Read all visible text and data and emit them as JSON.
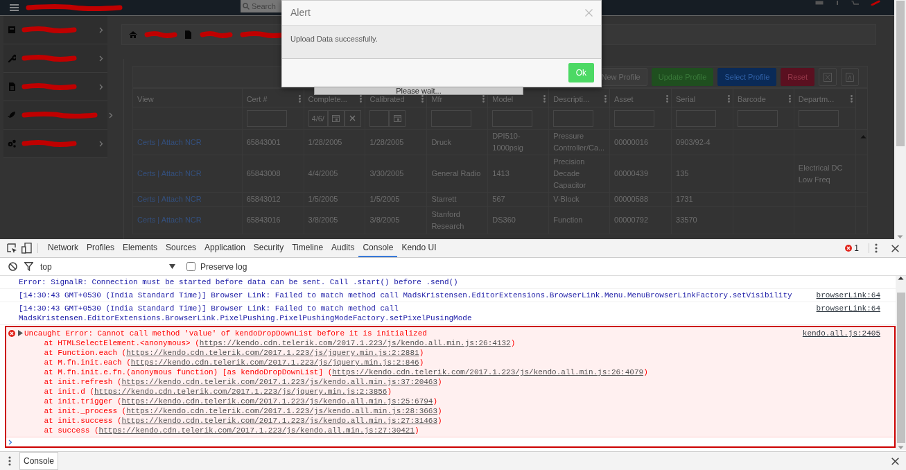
{
  "navbar": {
    "brand_redacted": true,
    "search": {
      "placeholder": "Search"
    },
    "corner_redacted": true
  },
  "sidebar": {
    "items": [
      {
        "redacted": true
      },
      {
        "redacted": true
      },
      {
        "redacted": true
      },
      {
        "redacted": true
      },
      {
        "redacted": true
      }
    ]
  },
  "breadcrumb": {
    "items": [
      {
        "redacted": true
      },
      {
        "redacted": true
      },
      {
        "redacted": true
      }
    ]
  },
  "toolbar": {
    "buttons": [
      {
        "label": "New Profile",
        "kind": "default"
      },
      {
        "label": "Update Profile",
        "kind": "success"
      },
      {
        "label": "Select Profile",
        "kind": "primary"
      },
      {
        "label": "Reset",
        "kind": "danger"
      }
    ]
  },
  "table": {
    "columns": [
      {
        "label": "View",
        "menu": false
      },
      {
        "label": "Cert #",
        "menu": true
      },
      {
        "label": "Complete...",
        "menu": true
      },
      {
        "label": "Calibrated",
        "menu": true
      },
      {
        "label": "Mfr",
        "menu": true
      },
      {
        "label": "Model",
        "menu": true
      },
      {
        "label": "Descripti...",
        "menu": true
      },
      {
        "label": "Asset",
        "menu": true
      },
      {
        "label": "Serial",
        "menu": true
      },
      {
        "label": "Barcode",
        "menu": true
      },
      {
        "label": "Departm...",
        "menu": true
      }
    ],
    "filters": [
      {
        "kind": "none"
      },
      {
        "kind": "text"
      },
      {
        "kind": "date",
        "value": "4/6/",
        "clearable": true
      },
      {
        "kind": "date",
        "clearable": false
      },
      {
        "kind": "text"
      },
      {
        "kind": "text"
      },
      {
        "kind": "text"
      },
      {
        "kind": "text"
      },
      {
        "kind": "text"
      },
      {
        "kind": "text"
      },
      {
        "kind": "text"
      }
    ],
    "rows": [
      {
        "cells": [
          {
            "links": [
              "Certs",
              "|",
              "Attach NCR"
            ]
          },
          "65843001",
          "1/28/2005",
          "1/28/2005",
          "Druck",
          "DPI510-1000psig",
          "Pressure Controller/Ca...",
          "00000016",
          "0903/92-4",
          "",
          ""
        ]
      },
      {
        "cells": [
          {
            "links": [
              "Certs",
              "|",
              "Attach NCR"
            ]
          },
          "65843008",
          "4/4/2005",
          "3/30/2005",
          "General Radio",
          "1413",
          "Precision Decade Capacitor",
          "00000439",
          "135",
          "",
          "Electrical DC Low Freq"
        ]
      },
      {
        "cells": [
          {
            "links": [
              "Certs",
              "|",
              "Attach NCR"
            ]
          },
          "65843012",
          "1/5/2005",
          "1/5/2005",
          "Starrett",
          "567",
          "V-Block",
          "00000588",
          "1731",
          "",
          ""
        ]
      },
      {
        "cells": [
          {
            "links": [
              "Certs",
              "|",
              "Attach NCR"
            ]
          },
          "65843016",
          "3/8/2005",
          "3/8/2005",
          "Stanford Research",
          "DS360",
          "Function",
          "00000792",
          "33570",
          "",
          ""
        ]
      }
    ]
  },
  "modal": {
    "title": "Alert",
    "message": "Upload Data successfully.",
    "ok": "Ok"
  },
  "loading": {
    "text": "Please wait..."
  },
  "devtools": {
    "tabs": [
      {
        "label": "Network",
        "selected": false
      },
      {
        "label": "Profiles",
        "selected": false
      },
      {
        "label": "Elements",
        "selected": false
      },
      {
        "label": "Sources",
        "selected": false
      },
      {
        "label": "Application",
        "selected": false
      },
      {
        "label": "Security",
        "selected": false
      },
      {
        "label": "Timeline",
        "selected": false
      },
      {
        "label": "Audits",
        "selected": false
      },
      {
        "label": "Console",
        "selected": true
      },
      {
        "label": "Kendo UI",
        "selected": false
      }
    ],
    "error_count": "1",
    "context": "top",
    "preserve_log": {
      "label": "Preserve log",
      "checked": false
    },
    "messages": [
      {
        "kind": "log",
        "text": "Error: SignalR: Connection must be started before data can be sent. Call .start() before .send()"
      },
      {
        "kind": "log",
        "text": "[14:30:43 GMT+0530 (India Standard Time)] Browser Link: Failed to match method call MadsKristensen.EditorExtensions.BrowserLink.Menu.MenuBrowserLinkFactory.setVisibility",
        "source": "browserLink:64"
      },
      {
        "kind": "log",
        "text": "[14:30:43 GMT+0530 (India Standard Time)] Browser Link: Failed to match method call MadsKristensen.EditorExtensions.BrowserLink.PixelPushing.PixelPushingModeFactory.setPixelPusingMode",
        "source": "browserLink:64"
      },
      {
        "kind": "error",
        "expanded": false,
        "text": "Uncaught Error: Cannot call method 'value' of kendoDropDownList before it is initialized",
        "source": "kendo.all.js:2405",
        "stack": [
          {
            "call": "at HTMLSelectElement.<anonymous> (",
            "url": "https://kendo.cdn.telerik.com/2017.1.223/js/kendo.all.min.js:26:4132",
            "end": ")"
          },
          {
            "call": "at Function.each (",
            "url": "https://kendo.cdn.telerik.com/2017.1.223/js/jquery.min.js:2:2881",
            "end": ")"
          },
          {
            "call": "at M.fn.init.each (",
            "url": "https://kendo.cdn.telerik.com/2017.1.223/js/jquery.min.js:2:846",
            "end": ")"
          },
          {
            "call": "at M.fn.init.e.fn.(anonymous function) [as kendoDropDownList] (",
            "url": "https://kendo.cdn.telerik.com/2017.1.223/js/kendo.all.min.js:26:4079",
            "end": ")"
          },
          {
            "call": "at init.refresh (",
            "url": "https://kendo.cdn.telerik.com/2017.1.223/js/kendo.all.min.js:37:20463",
            "end": ")"
          },
          {
            "call": "at init.d (",
            "url": "https://kendo.cdn.telerik.com/2017.1.223/js/jquery.min.js:2:3856",
            "end": ")"
          },
          {
            "call": "at init.trigger (",
            "url": "https://kendo.cdn.telerik.com/2017.1.223/js/kendo.all.min.js:25:6794",
            "end": ")"
          },
          {
            "call": "at init._process (",
            "url": "https://kendo.cdn.telerik.com/2017.1.223/js/kendo.all.min.js:28:3663",
            "end": ")"
          },
          {
            "call": "at init.success (",
            "url": "https://kendo.cdn.telerik.com/2017.1.223/js/kendo.all.min.js:27:31463",
            "end": ")"
          },
          {
            "call": "at success (",
            "url": "https://kendo.cdn.telerik.com/2017.1.223/js/kendo.all.min.js:27:30421",
            "end": ")"
          }
        ]
      }
    ],
    "drawer": {
      "tabs": [
        {
          "label": "Console"
        }
      ]
    }
  }
}
